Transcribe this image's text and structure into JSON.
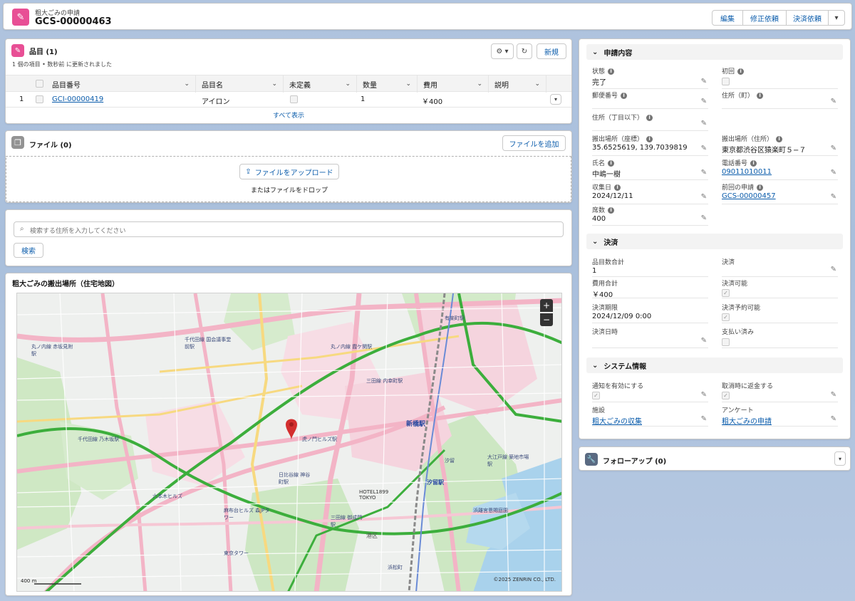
{
  "header": {
    "object_label": "粗大ごみの申請",
    "record_name": "GCS-00000463",
    "buttons": [
      "編集",
      "修正依頼",
      "決済依頼"
    ]
  },
  "items_card": {
    "title": "品目 (1)",
    "subtitle": "1 個の項目 • 数秒前 に更新されました",
    "new_label": "新規",
    "columns": [
      "品目番号",
      "品目名",
      "未定義",
      "数量",
      "費用",
      "説明"
    ],
    "rows": [
      {
        "num": "1",
        "item_no": "GCI-00000419",
        "item_name": "アイロン",
        "qty": "1",
        "cost": "￥400"
      }
    ],
    "view_all": "すべて表示"
  },
  "files_card": {
    "title": "ファイル (0)",
    "add_label": "ファイルを追加",
    "upload_label": "ファイルをアップロード",
    "drop_text": "またはファイルをドロップ"
  },
  "search_card": {
    "placeholder": "検索する住所を入力してください",
    "button": "検索"
  },
  "map_card": {
    "title": "粗大ごみの搬出場所（住宅地図）",
    "scale_label": "400 m",
    "copyright": "©2025 ZENRIN CO., LTD.",
    "labels": [
      "丸ノ内線 赤坂見附駅",
      "千代田線 国会議事堂前駅",
      "丸ノ内線 霞ケ関駅",
      "三田線 内幸町駅",
      "新橋駅",
      "汐留駅",
      "日比谷線 神谷町駅",
      "六本木ヒルズ",
      "麻布台ヒルズ 森JPタワー",
      "東京タワー",
      "浜離宮恩賜庭園",
      "HOTEL1899 TOKYO",
      "虎ノ門ヒルズ駅",
      "有楽町駅",
      "千代田線 乃木坂駅",
      "大江戸線 築地市場駅",
      "三田線 御成門駅",
      "港区",
      "浜松町",
      "汐留"
    ]
  },
  "details": {
    "sections": {
      "application": "申請内容",
      "payment": "決済",
      "system": "システム情報"
    },
    "status_label": "状態",
    "status_value": "完了",
    "first_time_label": "初回",
    "postal_label": "郵便番号",
    "address_town_label": "住所（町）",
    "address_chome_label": "住所（丁目以下）",
    "location_coords_label": "搬出場所（座標）",
    "location_coords_value": "35.6525619, 139.7039819",
    "location_address_label": "搬出場所（住所）",
    "location_address_value": "東京都渋谷区猿楽町５−７",
    "name_label": "氏名",
    "name_value": "中嶋一樹",
    "phone_label": "電話番号",
    "phone_value": "09011010011",
    "collection_date_label": "収集日",
    "collection_date_value": "2024/12/11",
    "previous_label": "前回の申請",
    "previous_value": "GCS-00000457",
    "seats_label": "席数",
    "seats_value": "400",
    "item_total_label": "品目数合計",
    "item_total_value": "1",
    "payment_label": "決済",
    "cost_total_label": "費用合計",
    "cost_total_value": "￥400",
    "payable_label": "決済可能",
    "deadline_label": "決済期限",
    "deadline_value": "2024/12/09 0:00",
    "reservable_label": "決済予約可能",
    "paid_datetime_label": "決済日時",
    "paid_label": "支払い済み",
    "notify_label": "通知を有効にする",
    "refund_label": "取消時に返金する",
    "facility_label": "施設",
    "facility_value": "粗大ごみの収集",
    "survey_label": "アンケート",
    "survey_value": "粗大ごみの申請"
  },
  "followup": {
    "title": "フォローアップ (0)"
  },
  "colors": {
    "brand_pink": "#e84f95",
    "link": "#0b5cab",
    "map_green": "#3cae3c",
    "map_pink": "#f3b4c6",
    "map_pin": "#d32f2f"
  },
  "icons": [
    "broom-icon",
    "gear-icon",
    "refresh-icon",
    "file-icon",
    "upload-icon",
    "search-icon",
    "pencil-icon",
    "info-icon",
    "wrench-icon",
    "chevron-down-icon",
    "map-pin-icon",
    "zoom-in-icon",
    "zoom-out-icon"
  ]
}
